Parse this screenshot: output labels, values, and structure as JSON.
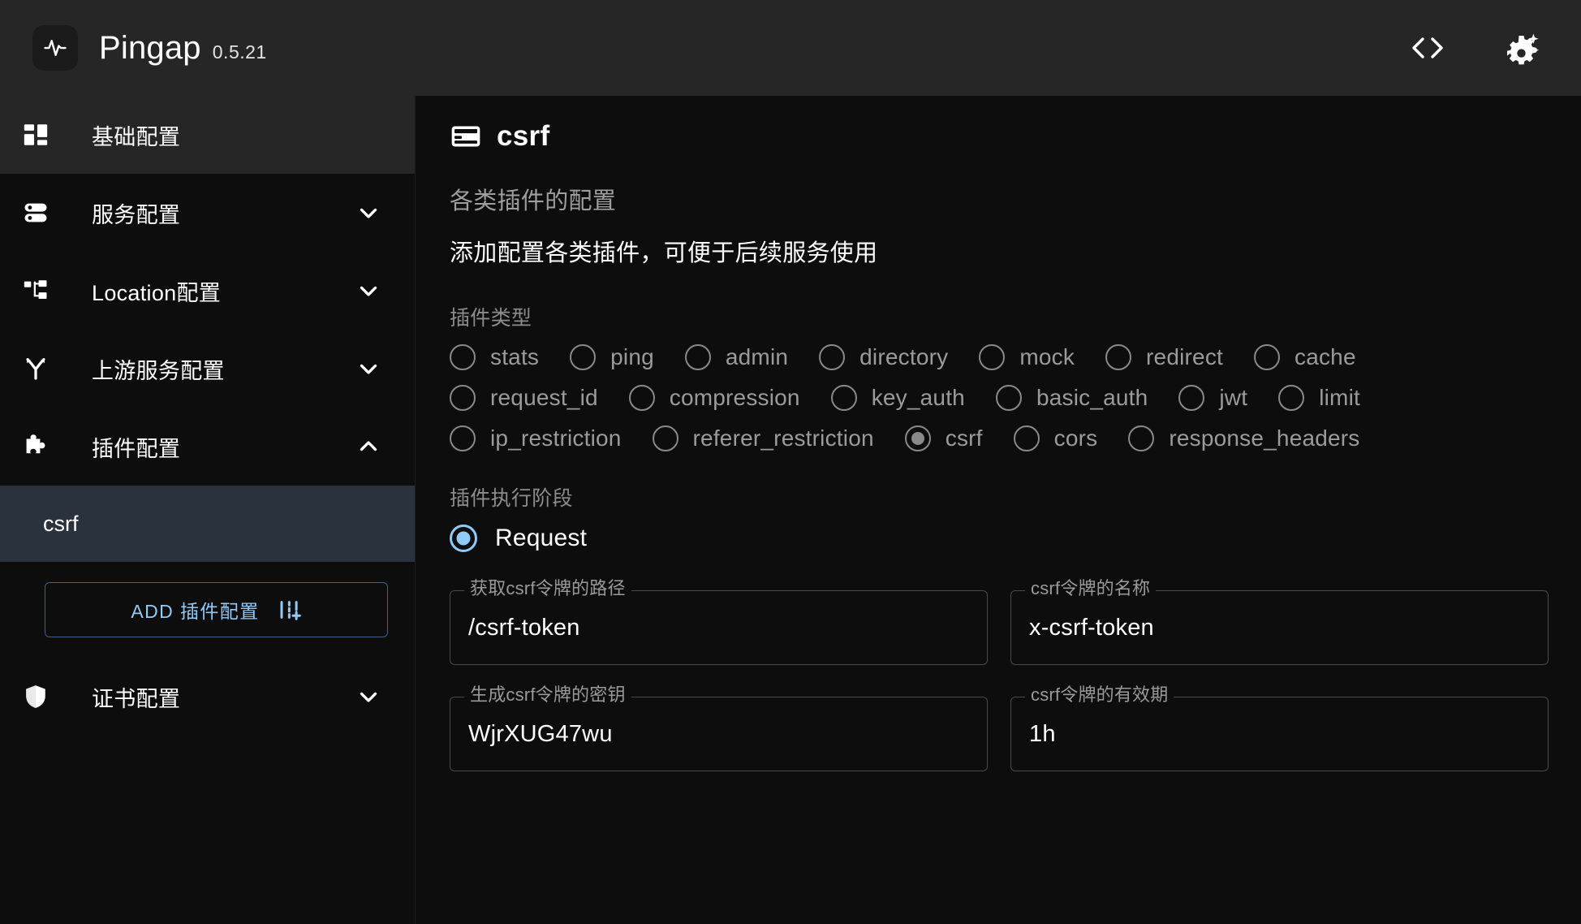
{
  "app": {
    "brand_name": "Pingap",
    "version": "0.5.21",
    "accent_blue": "#90caf9",
    "selected_bg": "#2a333d"
  },
  "topbar": {
    "code_icon": "code-brackets-icon",
    "settings_icon": "gear-sparkle-icon"
  },
  "sidebar": {
    "items": [
      {
        "label": "基础配置",
        "icon": "dashboard-icon",
        "active": true,
        "expandable": false
      },
      {
        "label": "服务配置",
        "icon": "server-icon",
        "active": false,
        "expandable": true,
        "expanded": false
      },
      {
        "label": "Location配置",
        "icon": "sitemap-icon",
        "active": false,
        "expandable": true,
        "expanded": false
      },
      {
        "label": "上游服务配置",
        "icon": "branch-icon",
        "active": false,
        "expandable": true,
        "expanded": false
      },
      {
        "label": "插件配置",
        "icon": "puzzle-icon",
        "active": false,
        "expandable": true,
        "expanded": true
      },
      {
        "label": "证书配置",
        "icon": "shield-icon",
        "active": false,
        "expandable": true,
        "expanded": false
      }
    ],
    "plugin_children": [
      {
        "label": "csrf",
        "selected": true
      }
    ],
    "add_button_label": "ADD 插件配置",
    "add_button_icon": "add-settings-icon"
  },
  "main": {
    "title": "csrf",
    "title_icon": "plugin-card-icon",
    "section_title": "各类插件的配置",
    "section_desc": "添加配置各类插件，可便于后续服务使用",
    "plugin_type_label": "插件类型",
    "plugin_types": [
      [
        {
          "label": "stats",
          "checked": false
        },
        {
          "label": "ping",
          "checked": false
        },
        {
          "label": "admin",
          "checked": false
        },
        {
          "label": "directory",
          "checked": false
        },
        {
          "label": "mock",
          "checked": false
        },
        {
          "label": "redirect",
          "checked": false
        },
        {
          "label": "cache",
          "checked": false
        }
      ],
      [
        {
          "label": "request_id",
          "checked": false
        },
        {
          "label": "compression",
          "checked": false
        },
        {
          "label": "key_auth",
          "checked": false
        },
        {
          "label": "basic_auth",
          "checked": false
        },
        {
          "label": "jwt",
          "checked": false
        },
        {
          "label": "limit",
          "checked": false
        }
      ],
      [
        {
          "label": "ip_restriction",
          "checked": false
        },
        {
          "label": "referer_restriction",
          "checked": false
        },
        {
          "label": "csrf",
          "checked": true
        },
        {
          "label": "cors",
          "checked": false
        },
        {
          "label": "response_headers",
          "checked": false
        }
      ]
    ],
    "stage_label": "插件执行阶段",
    "stage_options": [
      {
        "label": "Request",
        "checked": true
      }
    ],
    "fields": [
      {
        "label": "获取csrf令牌的路径",
        "value": "/csrf-token"
      },
      {
        "label": "csrf令牌的名称",
        "value": "x-csrf-token"
      },
      {
        "label": "生成csrf令牌的密钥",
        "value": "WjrXUG47wu"
      },
      {
        "label": "csrf令牌的有效期",
        "value": "1h"
      }
    ]
  }
}
